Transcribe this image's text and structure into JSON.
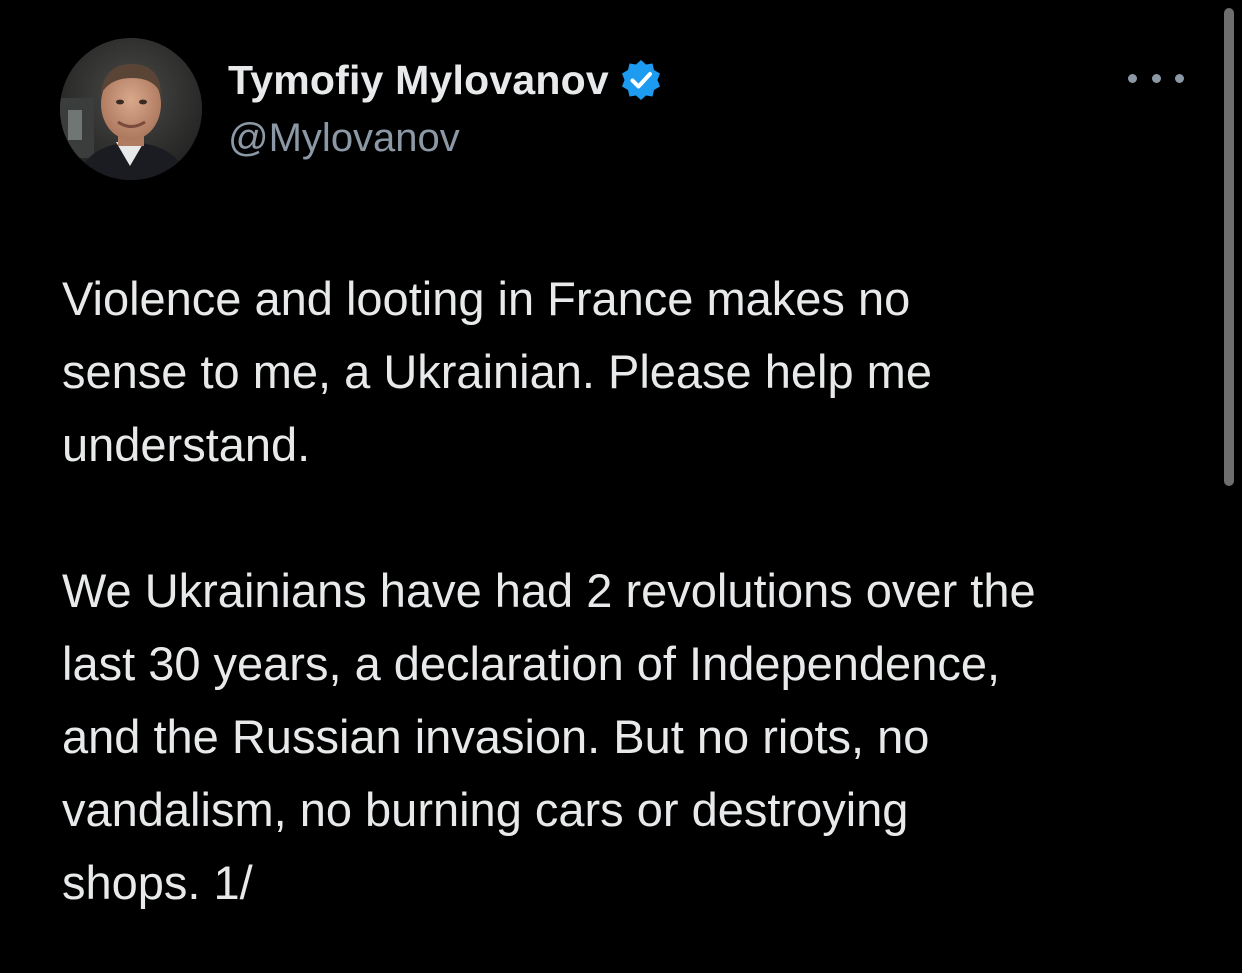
{
  "tweet": {
    "author": {
      "display_name": "Tymofiy Mylovanov",
      "handle": "@Mylovanov",
      "verified": true,
      "avatar_icon": "profile-photo"
    },
    "more_icon": "more-horizontal-icon",
    "body_paragraphs": [
      [
        "Violence and looting in France makes no",
        "sense to me, a Ukrainian. Please help me",
        "understand."
      ],
      [
        "We Ukrainians have had 2 revolutions over the",
        "last 30 years, a declaration of Independence,",
        "and the Russian invasion. But no riots, no",
        "vandalism, no burning cars or destroying",
        "shops. 1/"
      ]
    ]
  },
  "colors": {
    "background": "#000000",
    "text_primary": "#e7e9ea",
    "text_secondary": "#8b98a5",
    "verified_badge": "#1d9bf0",
    "scrollbar": "#6e6e6e"
  }
}
